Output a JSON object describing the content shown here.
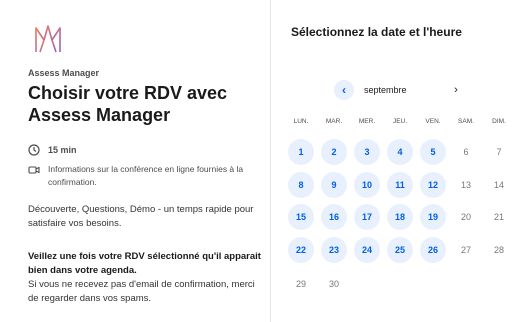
{
  "event": {
    "host": "Assess Manager",
    "title": "Choisir votre RDV avec Assess Manager",
    "duration": "15 min",
    "conference_info": "Informations sur la conférence en ligne fournies à la confirmation.",
    "description": "Découverte, Questions, Démo - un temps rapide pour satisfaire vos besoins.",
    "warning_bold": "Veillez une fois votre RDV sélectionné qu'il apparait bien dans votre agenda.",
    "warning_text": "Si vous ne recevez pas d'email de confirmation, merci de regarder dans vos spams.",
    "logo_icon": "brand-logo-icon",
    "accent_color": "#0060e6"
  },
  "calendar": {
    "title": "Sélectionnez la date et l'heure",
    "month": "septembre",
    "prev_icon": "chevron-left-icon",
    "next_icon": "chevron-right-icon",
    "weekdays": [
      "LUN.",
      "MAR.",
      "MER.",
      "JEU.",
      "VEN.",
      "SAM.",
      "DIM."
    ],
    "weeks": [
      [
        {
          "d": "1",
          "a": true
        },
        {
          "d": "2",
          "a": true
        },
        {
          "d": "3",
          "a": true
        },
        {
          "d": "4",
          "a": true
        },
        {
          "d": "5",
          "a": true
        },
        {
          "d": "6",
          "a": false
        },
        {
          "d": "7",
          "a": false
        }
      ],
      [
        {
          "d": "8",
          "a": true
        },
        {
          "d": "9",
          "a": true
        },
        {
          "d": "10",
          "a": true
        },
        {
          "d": "11",
          "a": true
        },
        {
          "d": "12",
          "a": true
        },
        {
          "d": "13",
          "a": false
        },
        {
          "d": "14",
          "a": false
        }
      ],
      [
        {
          "d": "15",
          "a": true
        },
        {
          "d": "16",
          "a": true
        },
        {
          "d": "17",
          "a": true
        },
        {
          "d": "18",
          "a": true
        },
        {
          "d": "19",
          "a": true
        },
        {
          "d": "20",
          "a": false
        },
        {
          "d": "21",
          "a": false
        }
      ],
      [
        {
          "d": "22",
          "a": true
        },
        {
          "d": "23",
          "a": true
        },
        {
          "d": "24",
          "a": true
        },
        {
          "d": "25",
          "a": true
        },
        {
          "d": "26",
          "a": true
        },
        {
          "d": "27",
          "a": false
        },
        {
          "d": "28",
          "a": false
        }
      ],
      [
        {
          "d": "29",
          "a": false
        },
        {
          "d": "30",
          "a": false
        }
      ]
    ],
    "available_bg": "#e8f0fe"
  }
}
